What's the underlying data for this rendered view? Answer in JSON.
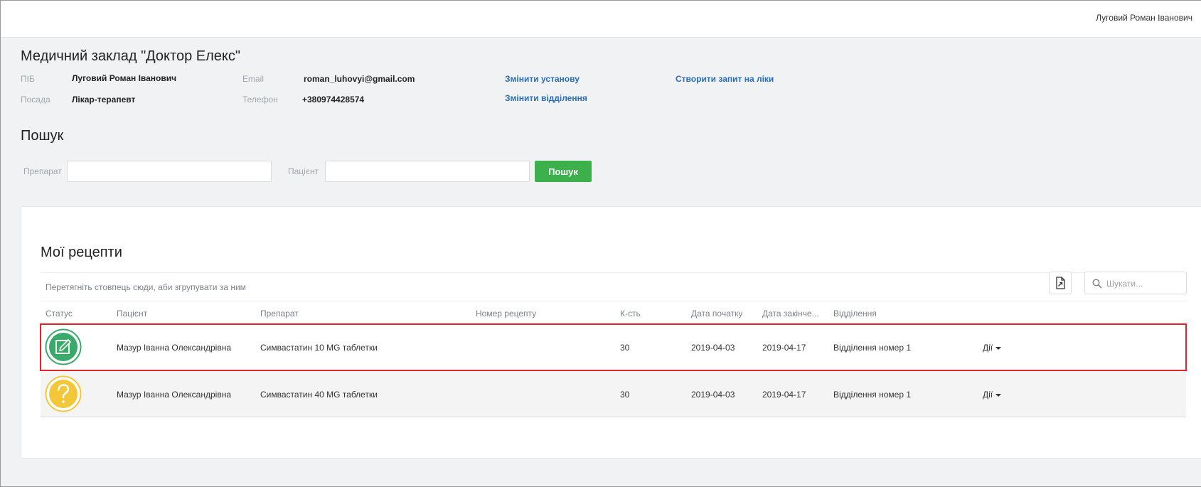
{
  "header": {
    "user_name": "Луговий Роман Іванович"
  },
  "clinic": {
    "title": "Медичний заклад \"Доктор Елекс\""
  },
  "profile": {
    "name_label": "ПІБ",
    "name_value": "Луговий Роман Іванович",
    "position_label": "Посада",
    "position_value": "Лікар-терапевт",
    "email_label": "Email",
    "email_value": "roman_luhovyi@gmail.com",
    "phone_label": "Телефон",
    "phone_value": "+380974428574",
    "change_institution": "Змінити установу",
    "change_department": "Змінити відділення",
    "create_request": "Створити запит на ліки"
  },
  "search": {
    "title": "Пошук",
    "drug_label": "Препарат",
    "patient_label": "Пацієнт",
    "button_label": "Пошук",
    "drug_value": "",
    "patient_value": ""
  },
  "prescriptions": {
    "title": "Мої рецепти",
    "group_hint": "Перетягніть стовпець сюди, аби згрупувати за ним",
    "search_placeholder": "Шукати...",
    "columns": {
      "status": "Статус",
      "patient": "Пацієнт",
      "drug": "Препарат",
      "number": "Номер рецепту",
      "qty": "К-сть",
      "start": "Дата початку",
      "end": "Дата закінче...",
      "department": "Відділення"
    },
    "rows": [
      {
        "status_icon": "edit-icon",
        "status_color": "#3aaa6a",
        "patient": "Мазур Іванна Олександрівна",
        "drug": "Симвастатин 10 MG таблетки",
        "number": "",
        "qty": "30",
        "start": "2019-04-03",
        "end": "2019-04-17",
        "department": "Відділення номер 1",
        "actions": "Дії"
      },
      {
        "status_icon": "question-icon",
        "status_color": "#f3c73a",
        "patient": "Мазур Іванна Олександрівна",
        "drug": "Симвастатин 40 MG таблетки",
        "number": "",
        "qty": "30",
        "start": "2019-04-03",
        "end": "2019-04-17",
        "department": "Відділення номер 1",
        "actions": "Дії"
      }
    ]
  }
}
